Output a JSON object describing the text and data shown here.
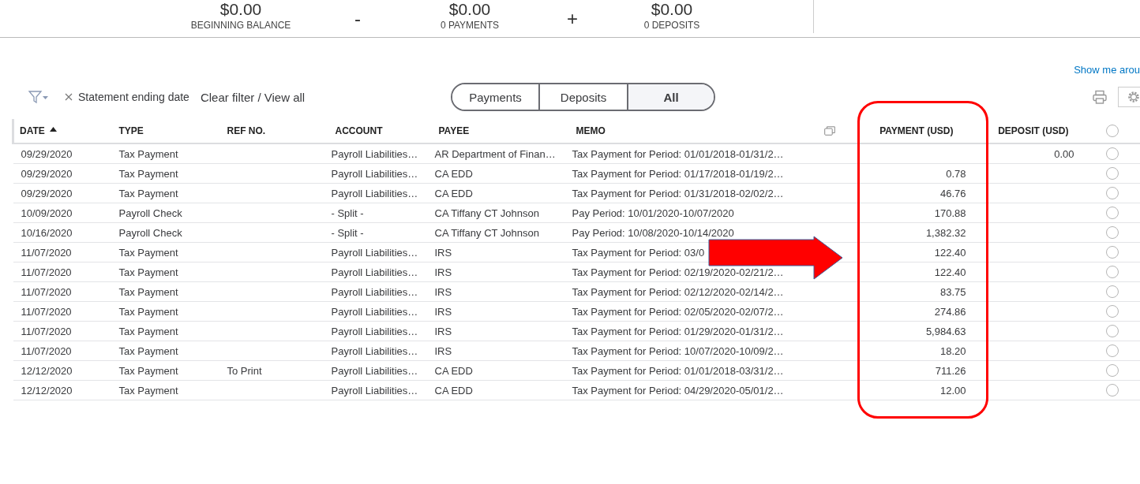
{
  "summary": [
    {
      "kind": "figure",
      "amount": "$0.00",
      "label": "BEGINNING BALANCE"
    },
    {
      "kind": "operator",
      "symbol": "-"
    },
    {
      "kind": "figure",
      "amount": "$0.00",
      "label": "0 PAYMENTS"
    },
    {
      "kind": "operator",
      "symbol": "+"
    },
    {
      "kind": "figure",
      "amount": "$0.00",
      "label": "0 DEPOSITS"
    }
  ],
  "help_link": "Show me arou",
  "filter": {
    "chip": "Statement ending date",
    "clear": "Clear filter / View all"
  },
  "segments": [
    {
      "label": "Payments",
      "selected": false
    },
    {
      "label": "Deposits",
      "selected": false
    },
    {
      "label": "All",
      "selected": true
    }
  ],
  "table": {
    "columns": [
      {
        "label": "DATE",
        "sorted": true
      },
      {
        "label": "TYPE",
        "sorted": false
      },
      {
        "label": "REF NO.",
        "sorted": false
      },
      {
        "label": "ACCOUNT",
        "sorted": false
      },
      {
        "label": "PAYEE",
        "sorted": false
      },
      {
        "label": "MEMO",
        "sorted": false
      },
      {
        "label": "PAYMENT (USD)",
        "sorted": false
      },
      {
        "label": "DEPOSIT (USD)",
        "sorted": false
      }
    ],
    "header_checked": false,
    "rows": [
      {
        "cells": [
          "09/29/2020",
          "Tax Payment",
          "",
          "Payroll Liabilities…",
          "AR Department of Finan…",
          "Tax Payment for Period: 01/01/2018-01/31/2…",
          "",
          "0.00"
        ],
        "checked": false
      },
      {
        "cells": [
          "09/29/2020",
          "Tax Payment",
          "",
          "Payroll Liabilities…",
          "CA EDD",
          "Tax Payment for Period: 01/17/2018-01/19/2…",
          "0.78",
          ""
        ],
        "checked": false
      },
      {
        "cells": [
          "09/29/2020",
          "Tax Payment",
          "",
          "Payroll Liabilities…",
          "CA EDD",
          "Tax Payment for Period: 01/31/2018-02/02/2…",
          "46.76",
          ""
        ],
        "checked": false
      },
      {
        "cells": [
          "10/09/2020",
          "Payroll Check",
          "",
          "- Split -",
          "CA Tiffany CT Johnson",
          "Pay Period: 10/01/2020-10/07/2020",
          "170.88",
          ""
        ],
        "checked": false
      },
      {
        "cells": [
          "10/16/2020",
          "Payroll Check",
          "",
          "- Split -",
          "CA Tiffany CT Johnson",
          "Pay Period: 10/08/2020-10/14/2020",
          "1,382.32",
          ""
        ],
        "checked": false
      },
      {
        "cells": [
          "11/07/2020",
          "Tax Payment",
          "",
          "Payroll Liabilities…",
          "IRS",
          "Tax Payment for Period: 03/0",
          "122.40",
          ""
        ],
        "checked": false
      },
      {
        "cells": [
          "11/07/2020",
          "Tax Payment",
          "",
          "Payroll Liabilities…",
          "IRS",
          "Tax Payment for Period: 02/19/2020-02/21/2…",
          "122.40",
          ""
        ],
        "checked": false
      },
      {
        "cells": [
          "11/07/2020",
          "Tax Payment",
          "",
          "Payroll Liabilities…",
          "IRS",
          "Tax Payment for Period: 02/12/2020-02/14/2…",
          "83.75",
          ""
        ],
        "checked": false
      },
      {
        "cells": [
          "11/07/2020",
          "Tax Payment",
          "",
          "Payroll Liabilities…",
          "IRS",
          "Tax Payment for Period: 02/05/2020-02/07/2…",
          "274.86",
          ""
        ],
        "checked": false
      },
      {
        "cells": [
          "11/07/2020",
          "Tax Payment",
          "",
          "Payroll Liabilities…",
          "IRS",
          "Tax Payment for Period: 01/29/2020-01/31/2…",
          "5,984.63",
          ""
        ],
        "checked": false
      },
      {
        "cells": [
          "11/07/2020",
          "Tax Payment",
          "",
          "Payroll Liabilities…",
          "IRS",
          "Tax Payment for Period: 10/07/2020-10/09/2…",
          "18.20",
          ""
        ],
        "checked": false
      },
      {
        "cells": [
          "12/12/2020",
          "Tax Payment",
          "To Print",
          "Payroll Liabilities…",
          "CA EDD",
          "Tax Payment for Period: 01/01/2018-03/31/2…",
          "711.26",
          ""
        ],
        "checked": false
      },
      {
        "cells": [
          "12/12/2020",
          "Tax Payment",
          "",
          "Payroll Liabilities…",
          "CA EDD",
          "Tax Payment for Period: 04/29/2020-05/01/2…",
          "12.00",
          ""
        ],
        "checked": false
      }
    ]
  }
}
